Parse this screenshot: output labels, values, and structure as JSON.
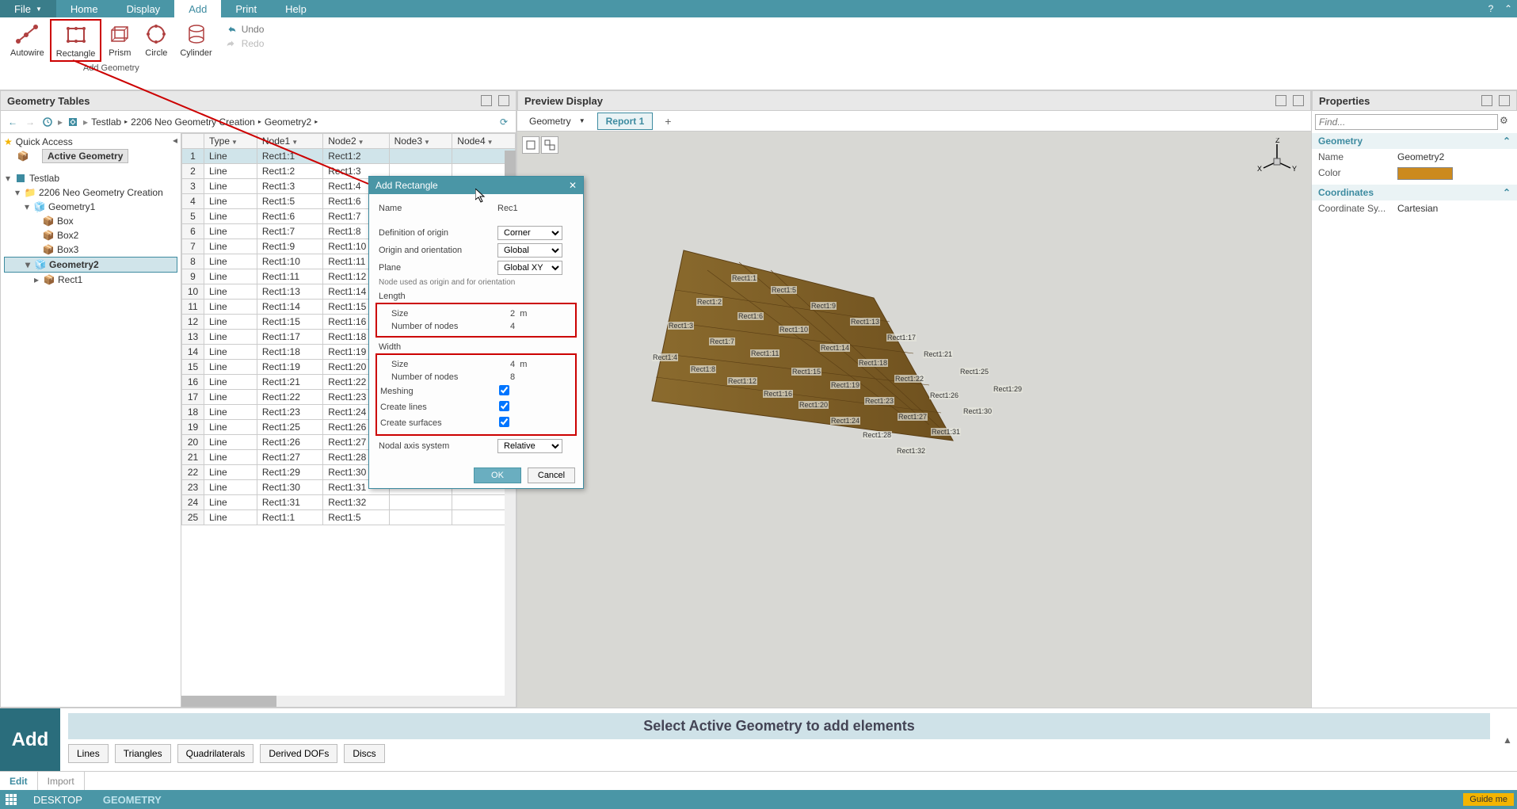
{
  "menubar": {
    "file": "File",
    "home": "Home",
    "display": "Display",
    "add": "Add",
    "print": "Print",
    "help": "Help"
  },
  "ribbon": {
    "group_label": "Add Geometry",
    "autowire": "Autowire",
    "rectangle": "Rectangle",
    "prism": "Prism",
    "circle": "Circle",
    "cylinder": "Cylinder",
    "undo": "Undo",
    "redo": "Redo"
  },
  "panels": {
    "geometry_tables": "Geometry Tables",
    "preview_display": "Preview Display",
    "properties": "Properties"
  },
  "breadcrumb": {
    "root": "Testlab",
    "proj": "2206 Neo Geometry Creation",
    "geom": "Geometry2"
  },
  "tree": {
    "quick_access": "Quick Access",
    "active_geometry": "Active Geometry",
    "root": "Testlab",
    "proj": "2206 Neo Geometry Creation",
    "geom1": "Geometry1",
    "box": "Box",
    "box2": "Box2",
    "box3": "Box3",
    "geom2": "Geometry2",
    "rect1": "Rect1"
  },
  "table": {
    "cols": {
      "type": "Type",
      "node1": "Node1",
      "node2": "Node2",
      "node3": "Node3",
      "node4": "Node4"
    },
    "rows": [
      {
        "n": 1,
        "t": "Line",
        "a": "Rect1:1",
        "b": "Rect1:2"
      },
      {
        "n": 2,
        "t": "Line",
        "a": "Rect1:2",
        "b": "Rect1:3"
      },
      {
        "n": 3,
        "t": "Line",
        "a": "Rect1:3",
        "b": "Rect1:4"
      },
      {
        "n": 4,
        "t": "Line",
        "a": "Rect1:5",
        "b": "Rect1:6"
      },
      {
        "n": 5,
        "t": "Line",
        "a": "Rect1:6",
        "b": "Rect1:7"
      },
      {
        "n": 6,
        "t": "Line",
        "a": "Rect1:7",
        "b": "Rect1:8"
      },
      {
        "n": 7,
        "t": "Line",
        "a": "Rect1:9",
        "b": "Rect1:10"
      },
      {
        "n": 8,
        "t": "Line",
        "a": "Rect1:10",
        "b": "Rect1:11"
      },
      {
        "n": 9,
        "t": "Line",
        "a": "Rect1:11",
        "b": "Rect1:12"
      },
      {
        "n": 10,
        "t": "Line",
        "a": "Rect1:13",
        "b": "Rect1:14"
      },
      {
        "n": 11,
        "t": "Line",
        "a": "Rect1:14",
        "b": "Rect1:15"
      },
      {
        "n": 12,
        "t": "Line",
        "a": "Rect1:15",
        "b": "Rect1:16"
      },
      {
        "n": 13,
        "t": "Line",
        "a": "Rect1:17",
        "b": "Rect1:18"
      },
      {
        "n": 14,
        "t": "Line",
        "a": "Rect1:18",
        "b": "Rect1:19"
      },
      {
        "n": 15,
        "t": "Line",
        "a": "Rect1:19",
        "b": "Rect1:20"
      },
      {
        "n": 16,
        "t": "Line",
        "a": "Rect1:21",
        "b": "Rect1:22"
      },
      {
        "n": 17,
        "t": "Line",
        "a": "Rect1:22",
        "b": "Rect1:23"
      },
      {
        "n": 18,
        "t": "Line",
        "a": "Rect1:23",
        "b": "Rect1:24"
      },
      {
        "n": 19,
        "t": "Line",
        "a": "Rect1:25",
        "b": "Rect1:26"
      },
      {
        "n": 20,
        "t": "Line",
        "a": "Rect1:26",
        "b": "Rect1:27"
      },
      {
        "n": 21,
        "t": "Line",
        "a": "Rect1:27",
        "b": "Rect1:28"
      },
      {
        "n": 22,
        "t": "Line",
        "a": "Rect1:29",
        "b": "Rect1:30"
      },
      {
        "n": 23,
        "t": "Line",
        "a": "Rect1:30",
        "b": "Rect1:31"
      },
      {
        "n": 24,
        "t": "Line",
        "a": "Rect1:31",
        "b": "Rect1:32"
      },
      {
        "n": 25,
        "t": "Line",
        "a": "Rect1:1",
        "b": "Rect1:5"
      }
    ]
  },
  "preview_tabs": {
    "geometry": "Geometry",
    "report1": "Report 1"
  },
  "axis_labels": {
    "x": "X",
    "y": "Y",
    "z": "Z"
  },
  "preview_node_labels": [
    "Rect1:1",
    "Rect1:2",
    "Rect1:3",
    "Rect1:4",
    "Rect1:5",
    "Rect1:6",
    "Rect1:7",
    "Rect1:8",
    "Rect1:9",
    "Rect1:10",
    "Rect1:11",
    "Rect1:12",
    "Rect1:13",
    "Rect1:14",
    "Rect1:15",
    "Rect1:16",
    "Rect1:17",
    "Rect1:18",
    "Rect1:19",
    "Rect1:20",
    "Rect1:21",
    "Rect1:22",
    "Rect1:23",
    "Rect1:24",
    "Rect1:25",
    "Rect1:26",
    "Rect1:27",
    "Rect1:28",
    "Rect1:29",
    "Rect1:30",
    "Rect1:31",
    "Rect1:32"
  ],
  "props": {
    "find_placeholder": "Find...",
    "section_geometry": "Geometry",
    "name_k": "Name",
    "name_v": "Geometry2",
    "color_k": "Color",
    "section_coords": "Coordinates",
    "coordsys_k": "Coordinate Sy...",
    "coordsys_v": "Cartesian"
  },
  "dialog": {
    "title": "Add Rectangle",
    "name_k": "Name",
    "name_v": "Rec1",
    "def_origin_k": "Definition of origin",
    "def_origin_v": "Corner",
    "orient_k": "Origin and orientation",
    "orient_v": "Global",
    "plane_k": "Plane",
    "plane_v": "Global XY",
    "note": "Node used as origin and for orientation",
    "length": "Length",
    "width": "Width",
    "size_k": "Size",
    "len_size_v": "2",
    "len_unit": "m",
    "wid_size_v": "4",
    "wid_unit": "m",
    "nodes_k": "Number of nodes",
    "len_nodes_v": "4",
    "wid_nodes_v": "8",
    "meshing_k": "Meshing",
    "create_lines_k": "Create lines",
    "create_surfaces_k": "Create surfaces",
    "nodal_k": "Nodal axis system",
    "nodal_v": "Relative",
    "ok": "OK",
    "cancel": "Cancel"
  },
  "process": {
    "big": "Add",
    "banner": "Select Active Geometry to add elements",
    "lines": "Lines",
    "triangles": "Triangles",
    "quads": "Quadrilaterals",
    "derived": "Derived DOFs",
    "discs": "Discs"
  },
  "bottom_tabs": {
    "edit": "Edit",
    "import": "Import"
  },
  "status": {
    "desktop": "DESKTOP",
    "geometry": "GEOMETRY",
    "guide": "Guide me"
  }
}
